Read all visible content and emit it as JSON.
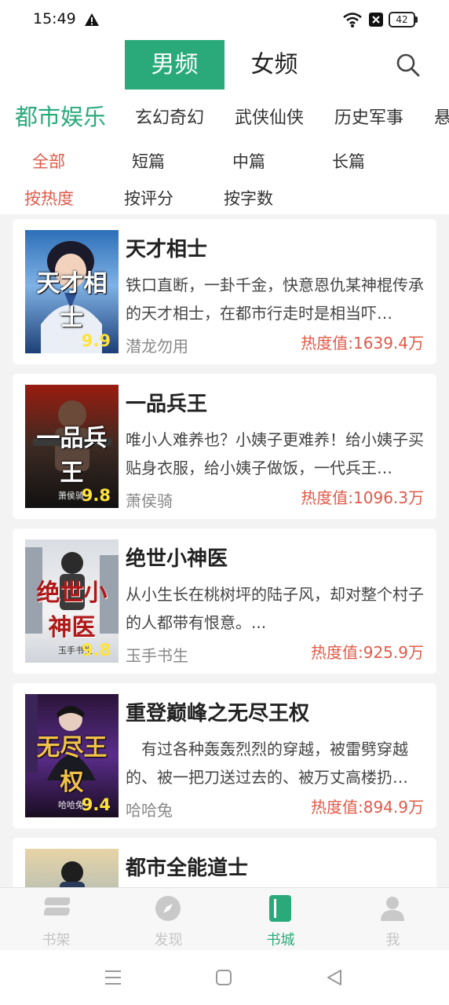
{
  "status_bar": {
    "time": "15:49",
    "battery": "42"
  },
  "gender_tabs": {
    "male": "男频",
    "female": "女频"
  },
  "categories": [
    "都市娱乐",
    "玄幻奇幻",
    "武侠仙侠",
    "历史军事",
    "悬"
  ],
  "length_filters": [
    "全部",
    "短篇",
    "中篇",
    "长篇"
  ],
  "sort_filters": [
    "按热度",
    "按评分",
    "按字数"
  ],
  "books": [
    {
      "title": "天才相士",
      "desc": "铁口直断，一卦千金，快意恩仇某神棍传承的天才相士，在都市行走时是相当吓…",
      "author": "潜龙勿用",
      "heat": "热度值:1639.4万",
      "score": "9.9",
      "cover_title": "天才相士",
      "cover_author": "潜龙勿用"
    },
    {
      "title": "一品兵王",
      "desc": "唯小人难养也？小姨子更难养！给小姨子买贴身衣服，给小姨子做饭，一代兵王…",
      "author": "萧侯骑",
      "heat": "热度值:1096.3万",
      "score": "9.8",
      "cover_title": "一品兵王",
      "cover_author": "萧侯骑"
    },
    {
      "title": "绝世小神医",
      "desc": "从小生长在桃树坪的陆子风，却对整个村子的人都带有恨意。...",
      "author": "玉手书生",
      "heat": "热度值:925.9万",
      "score": "9.8",
      "cover_title": "绝世小神医",
      "cover_author": "玉手书生"
    },
    {
      "title": "重登巅峰之无尽王权",
      "desc": "　有过各种轰轰烈烈的穿越，被雷劈穿越的、被一把刀送过去的、被万丈高楼扔…",
      "author": "哈哈兔",
      "heat": "热度值:894.9万",
      "score": "9.4",
      "cover_title": "无尽王权",
      "cover_author": "哈哈兔"
    },
    {
      "title": "都市全能道士",
      "desc": "",
      "author": "",
      "heat": "",
      "score": "",
      "cover_title": "",
      "cover_author": ""
    }
  ],
  "bottom_nav": [
    {
      "label": "书架",
      "icon": "bookshelf-icon"
    },
    {
      "label": "发现",
      "icon": "compass-icon"
    },
    {
      "label": "书城",
      "icon": "bookstore-icon"
    },
    {
      "label": "我",
      "icon": "profile-icon"
    }
  ],
  "colors": {
    "accent": "#2aaa7a",
    "heat": "#e05a4a",
    "score": "#ffe23a"
  }
}
